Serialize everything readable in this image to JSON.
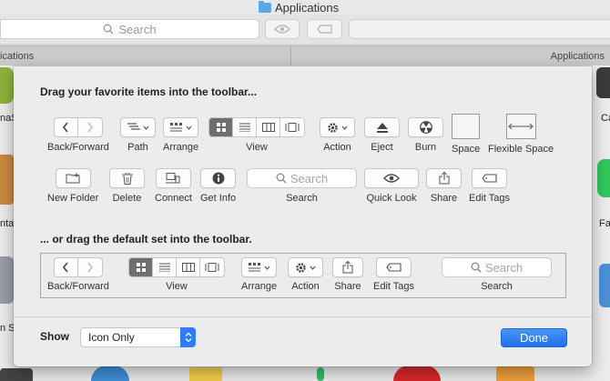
{
  "window": {
    "title": "Applications",
    "search_placeholder": "Search",
    "left_tab": "ications",
    "right_tab": "Applications"
  },
  "background_labels": {
    "l1": "naS",
    "l2": "nta",
    "l3": "n Si",
    "r1": "Ca",
    "r2": "Fa"
  },
  "sheet": {
    "drag_favorites_heading": "Drag your favorite items into the toolbar...",
    "drag_default_heading": "... or drag the default set into the toolbar.",
    "items": {
      "back_forward": "Back/Forward",
      "path": "Path",
      "arrange": "Arrange",
      "view": "View",
      "action": "Action",
      "eject": "Eject",
      "burn": "Burn",
      "space": "Space",
      "flexible_space": "Flexible Space",
      "new_folder": "New Folder",
      "delete": "Delete",
      "connect": "Connect",
      "get_info": "Get Info",
      "search": "Search",
      "quick_look": "Quick Look",
      "share": "Share",
      "edit_tags": "Edit Tags"
    },
    "search_placeholder": "Search",
    "default_set": {
      "back_forward": "Back/Forward",
      "view": "View",
      "arrange": "Arrange",
      "action": "Action",
      "share": "Share",
      "edit_tags": "Edit Tags",
      "search": "Search",
      "search_placeholder": "Search"
    },
    "show_label": "Show",
    "show_value": "Icon Only",
    "done_label": "Done"
  }
}
